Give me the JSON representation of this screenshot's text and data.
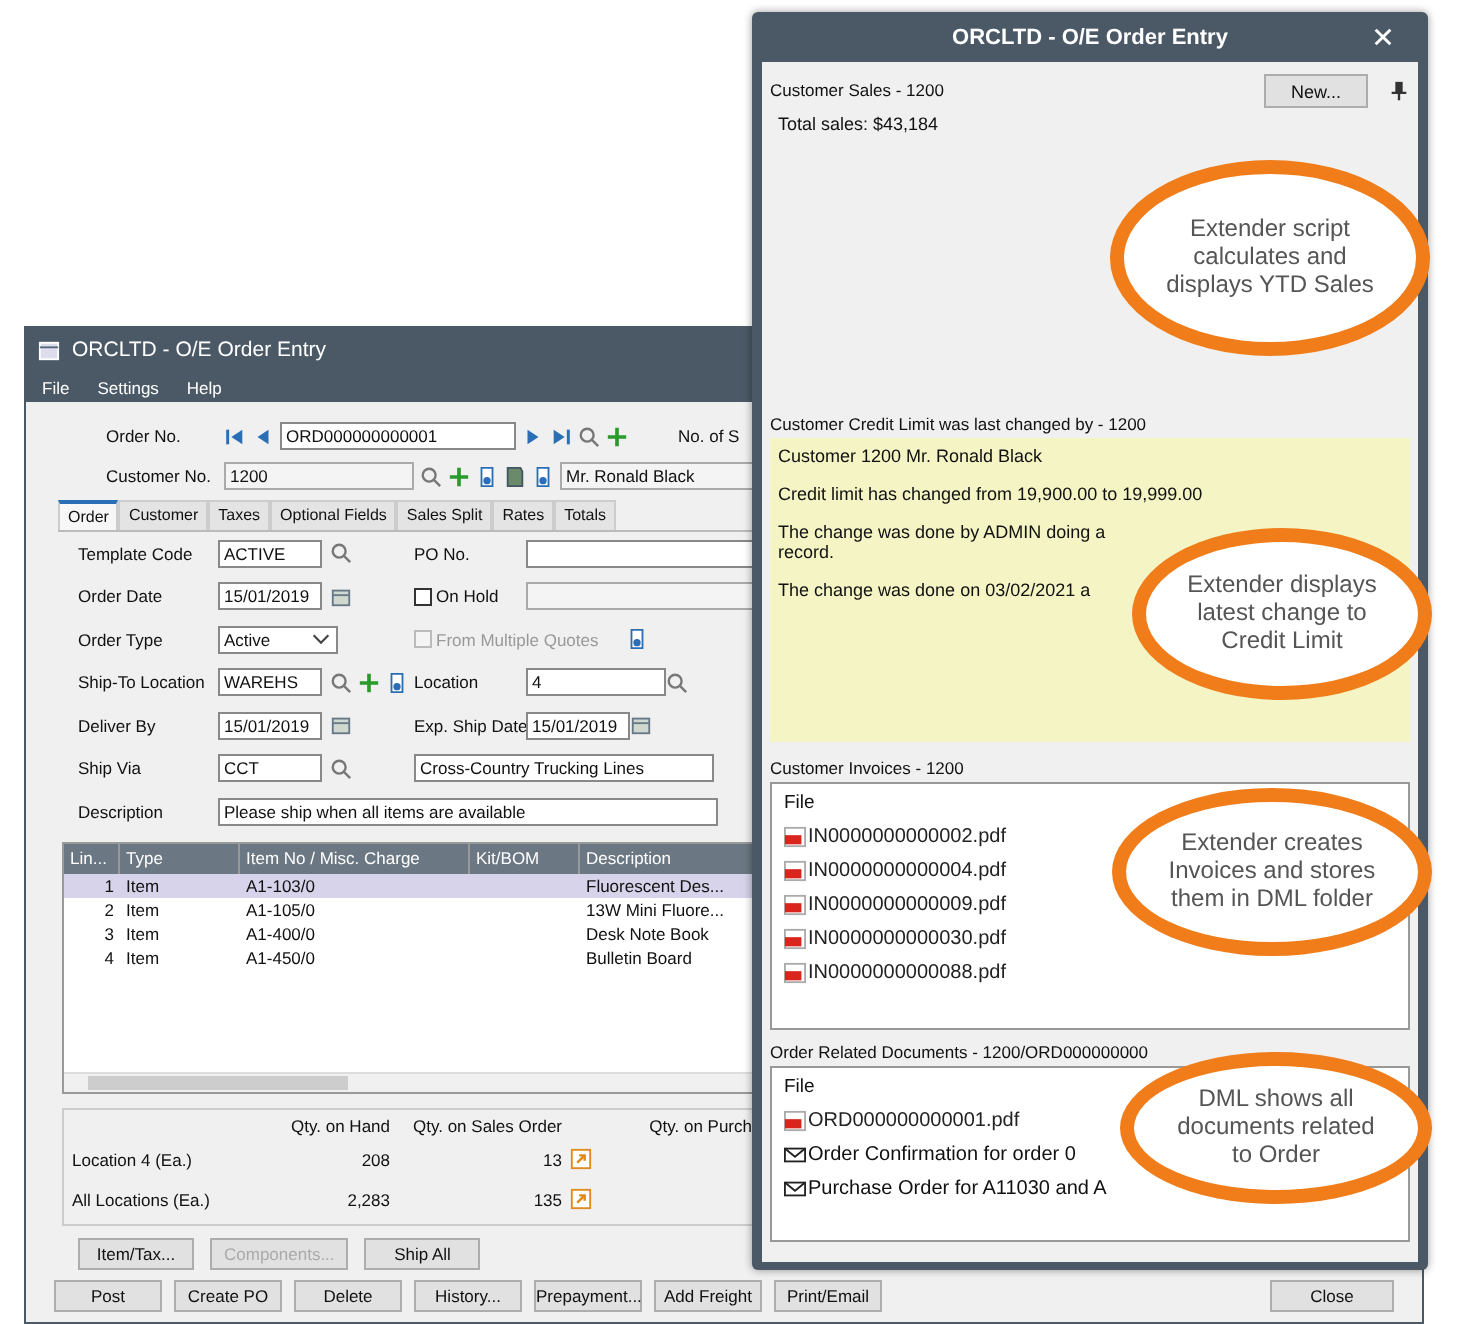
{
  "order_window": {
    "title": "ORCLTD - O/E Order Entry",
    "menu": [
      "File",
      "Settings",
      "Help"
    ],
    "order_no": {
      "label": "Order No.",
      "value": "ORD000000000001"
    },
    "no_of_label": "No. of S",
    "customer_no": {
      "label": "Customer No.",
      "value": "1200"
    },
    "customer_name": "Mr. Ronald Black",
    "tabs": [
      {
        "label": "Order",
        "selected": true
      },
      {
        "label": "Customer",
        "selected": false
      },
      {
        "label": "Taxes",
        "selected": false
      },
      {
        "label": "Optional Fields",
        "selected": false
      },
      {
        "label": "Sales Split",
        "selected": false
      },
      {
        "label": "Rates",
        "selected": false
      },
      {
        "label": "Totals",
        "selected": false
      }
    ],
    "template_code": {
      "label": "Template Code",
      "value": "ACTIVE"
    },
    "po_no": {
      "label": "PO No."
    },
    "order_date": {
      "label": "Order Date",
      "value": "15/01/2019"
    },
    "on_hold": {
      "label": "On Hold",
      "checked": false
    },
    "order_type": {
      "label": "Order Type",
      "value": "Active"
    },
    "from_multiple_quotes": {
      "label": "From Multiple Quotes",
      "checked": false,
      "disabled": true
    },
    "ship_to_location": {
      "label": "Ship-To Location",
      "value": "WAREHS"
    },
    "location": {
      "label": "Location",
      "value": "4"
    },
    "deliver_by": {
      "label": "Deliver By",
      "value": "15/01/2019"
    },
    "exp_ship_date": {
      "label": "Exp. Ship Date",
      "value": "15/01/2019"
    },
    "ship_via": {
      "label": "Ship Via",
      "value": "CCT",
      "name": "Cross-Country Trucking Lines"
    },
    "description": {
      "label": "Description",
      "value": "Please ship when all items are available"
    },
    "lines_table": {
      "columns": [
        "Lin...",
        "Type",
        "Item No / Misc. Charge",
        "Kit/BOM",
        "Description"
      ],
      "rows": [
        {
          "line": "1",
          "type": "Item",
          "item_no": "A1-103/0",
          "description": "Fluorescent Des...",
          "selected": true
        },
        {
          "line": "2",
          "type": "Item",
          "item_no": "A1-105/0",
          "description": "13W Mini Fluore...",
          "selected": false
        },
        {
          "line": "3",
          "type": "Item",
          "item_no": "A1-400/0",
          "description": "Desk Note Book",
          "selected": false
        },
        {
          "line": "4",
          "type": "Item",
          "item_no": "A1-450/0",
          "description": "Bulletin Board",
          "selected": false
        }
      ]
    },
    "quantities": {
      "columns": [
        "Qty. on Hand",
        "Qty. on Sales Order",
        "Qty. on Purch"
      ],
      "rows": [
        {
          "label": "Location 4 (Ea.)",
          "on_hand": "208",
          "on_sales_order": "13"
        },
        {
          "label": "All Locations (Ea.)",
          "on_hand": "2,283",
          "on_sales_order": "135"
        }
      ]
    },
    "line_buttons": [
      {
        "label": "Item/Tax...",
        "disabled": false
      },
      {
        "label": "Components...",
        "disabled": true
      },
      {
        "label": "Ship All",
        "disabled": false
      }
    ],
    "buttons": [
      "Post",
      "Create PO",
      "Delete",
      "History...",
      "Prepayment...",
      "Add Freight",
      "Print/Email",
      "Close"
    ]
  },
  "popup": {
    "title": "ORCLTD - O/E Order Entry",
    "sales": {
      "heading": "Customer Sales - 1200",
      "total": "Total sales: $43,184",
      "new_button": "New..."
    },
    "credit": {
      "heading": "Customer Credit Limit was last changed by - 1200",
      "lines": [
        "Customer 1200 Mr. Ronald Black",
        "Credit limit has changed from 19,900.00 to 19,999.00",
        "The change was done by ADMIN doing a",
        "record.",
        "The change was done on 03/02/2021 a"
      ]
    },
    "invoices": {
      "heading": "Customer Invoices - 1200",
      "column": "File",
      "files": [
        {
          "name": "IN0000000000002.pdf",
          "kind": "pdf"
        },
        {
          "name": "IN0000000000004.pdf",
          "kind": "pdf"
        },
        {
          "name": "IN0000000000009.pdf",
          "kind": "pdf"
        },
        {
          "name": "IN0000000000030.pdf",
          "kind": "pdf"
        },
        {
          "name": "IN0000000000088.pdf",
          "kind": "pdf"
        }
      ]
    },
    "documents": {
      "heading": "Order Related Documents - 1200/ORD000000000",
      "column": "File",
      "files": [
        {
          "name": "ORD000000000001.pdf",
          "kind": "pdf"
        },
        {
          "name": "Order Confirmation for order 0",
          "kind": "mail"
        },
        {
          "name": "Purchase Order for A11030 and A",
          "kind": "mail"
        }
      ]
    }
  },
  "callouts": [
    "Extender script calculates and displays YTD Sales",
    "Extender displays latest change to Credit Limit",
    "Extender creates Invoices and stores them in DML folder",
    "DML shows all documents related to Order"
  ]
}
